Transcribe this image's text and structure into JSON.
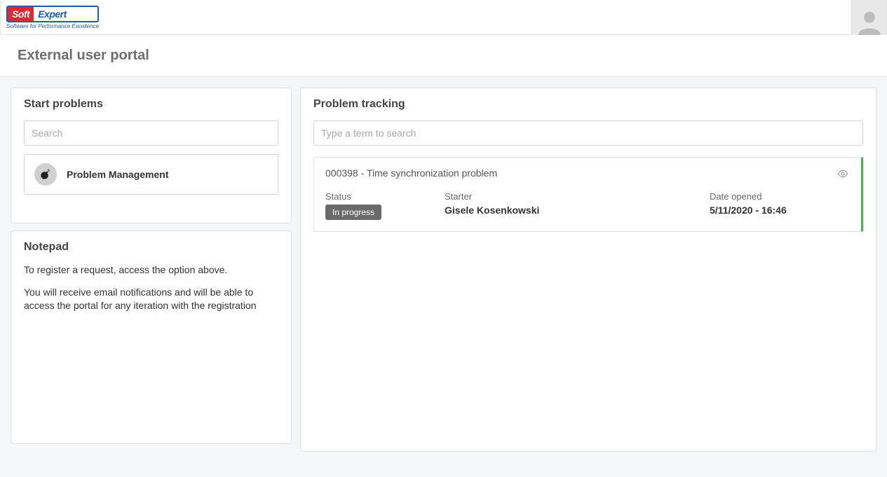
{
  "header": {
    "logo_left": "Soft",
    "logo_right": "Expert",
    "logo_tagline": "Software for Performance Excellence"
  },
  "page_title": "External user portal",
  "start_problems": {
    "heading": "Start problems",
    "search_placeholder": "Search",
    "types": [
      {
        "label": "Problem Management"
      }
    ]
  },
  "notepad": {
    "heading": "Notepad",
    "lines": [
      "To register a request, access the option above.",
      "You will receive email notifications and will be able to access the portal for any iteration with the registration"
    ]
  },
  "tracking": {
    "heading": "Problem tracking",
    "search_placeholder": "Type a term to search",
    "items": [
      {
        "title": "000398 - Time synchronization problem",
        "status_label": "Status",
        "status_value": "In progress",
        "starter_label": "Starter",
        "starter_value": "Gisele Kosenkowski",
        "date_label": "Date opened",
        "date_value": "5/11/2020 - 16:46"
      }
    ]
  }
}
